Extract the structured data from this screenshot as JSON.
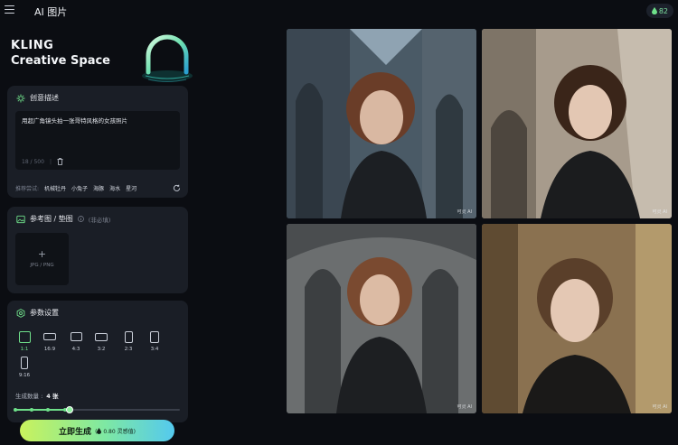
{
  "topbar": {
    "app_title": "AI 图片",
    "credits": "82"
  },
  "brand": {
    "line1": "KLING",
    "line2": "Creative Space"
  },
  "description_panel": {
    "title": "创意描述",
    "prompt_text": "用超广角镜头拍一张哥特风格的女孩照片",
    "char_count": "18 / 500",
    "suggest_label": "推荐尝试:",
    "suggestions": [
      "机械牡丹",
      "小兔子",
      "海豚",
      "海水",
      "星河"
    ]
  },
  "reference_panel": {
    "title": "参考图 / 垫图",
    "optional_label": "(非必填)",
    "upload_hint": "JPG / PNG"
  },
  "params_panel": {
    "title": "参数设置",
    "ratios": [
      "1:1",
      "16:9",
      "4:3",
      "3:2",
      "2:3",
      "3:4",
      "9:16"
    ],
    "selected_ratio": "1:1",
    "count_label": "生成数量 :",
    "count_value": "4 张",
    "count_fraction": 0.33
  },
  "generate": {
    "label": "立即生成",
    "cost": "0.80 灵感值"
  },
  "results": {
    "watermark": "可灵 AI",
    "count": 4
  },
  "colors": {
    "accent": "#6fe08a",
    "bg": "#0b0d12",
    "panel": "#1a1e26"
  }
}
